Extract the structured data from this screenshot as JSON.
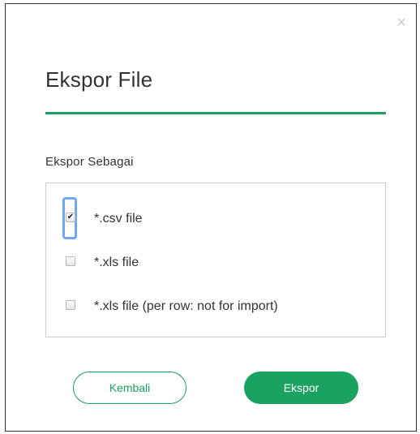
{
  "dialog": {
    "close_symbol": "×",
    "title": "Ekspor File",
    "section_label": "Ekspor Sebagai",
    "options": [
      {
        "label": "*.csv file",
        "checked": true,
        "check_symbol": "✔"
      },
      {
        "label": "*.xls file",
        "checked": false,
        "check_symbol": ""
      },
      {
        "label": "*.xls file (per row: not for import)",
        "checked": false,
        "check_symbol": ""
      }
    ],
    "buttons": {
      "back_label": "Kembali",
      "export_label": "Ekspor"
    }
  },
  "colors": {
    "accent": "#1aa260",
    "focus_ring": "#6ea8f2",
    "text": "#333333",
    "close_icon": "#c8c8c8"
  }
}
